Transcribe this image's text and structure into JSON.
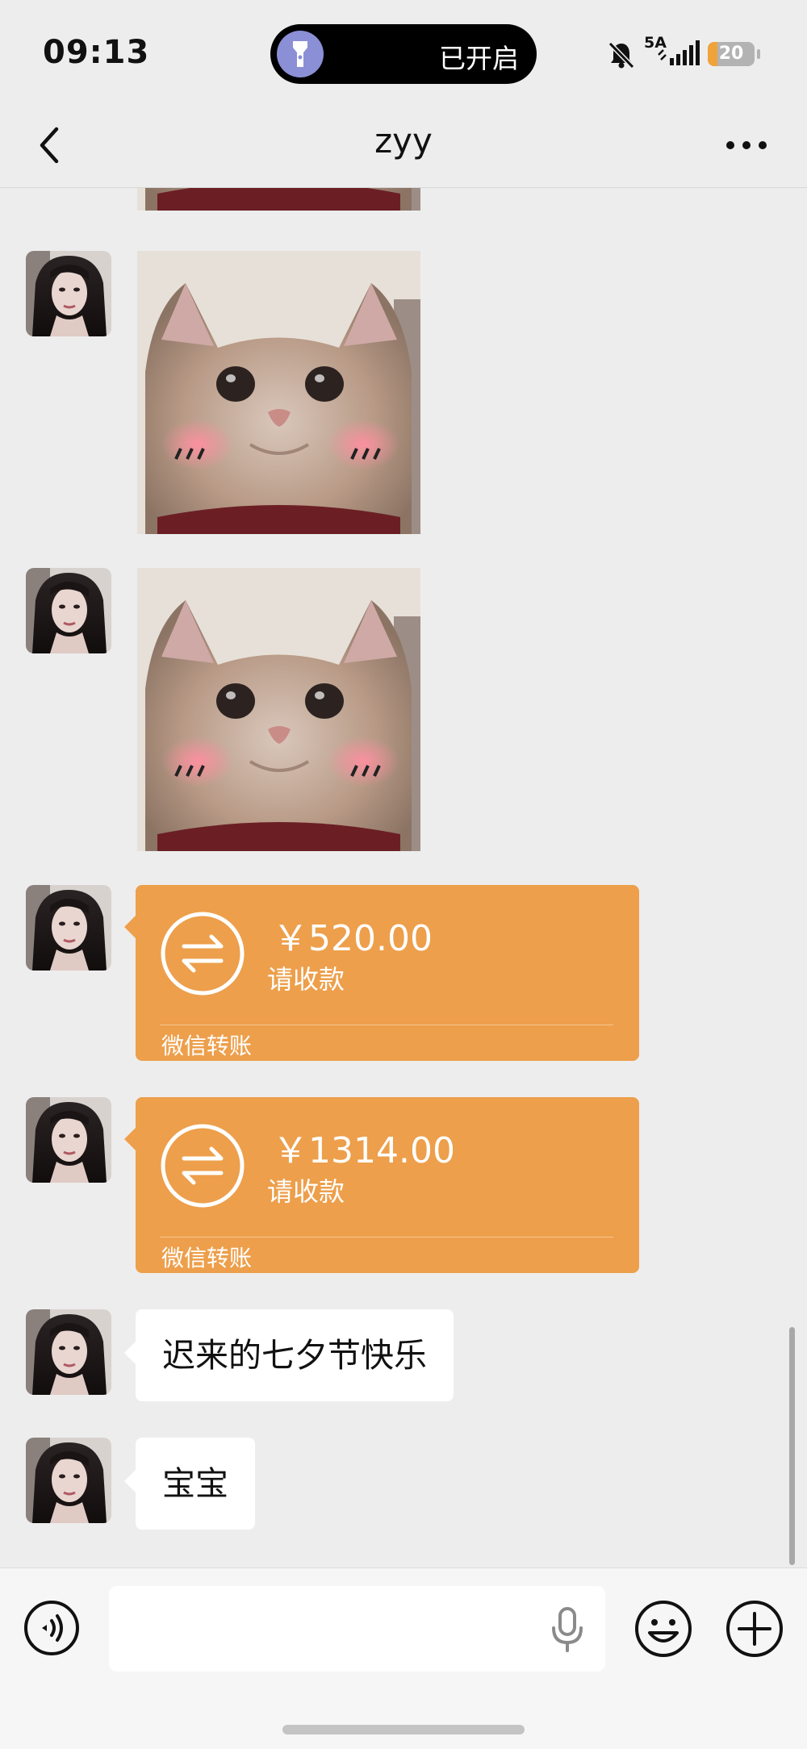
{
  "status_bar": {
    "time": "09:13",
    "island_text": "已开启",
    "network": "5A",
    "battery_level": "20",
    "battery_fraction": 0.2
  },
  "nav": {
    "title": "zyy",
    "back_icon": "chevron-left-icon",
    "more_icon": "more-dots-icon"
  },
  "messages": [
    {
      "type": "image",
      "sender": "contact",
      "description": "cat-sticker"
    },
    {
      "type": "image",
      "sender": "contact",
      "description": "cat-sticker"
    },
    {
      "type": "transfer",
      "sender": "contact",
      "amount": "￥520.00",
      "status": "请收款",
      "brand": "微信转账"
    },
    {
      "type": "transfer",
      "sender": "contact",
      "amount": "￥1314.00",
      "status": "请收款",
      "brand": "微信转账"
    },
    {
      "type": "text",
      "sender": "contact",
      "text": "迟来的七夕节快乐"
    },
    {
      "type": "text",
      "sender": "contact",
      "text": "宝宝"
    }
  ],
  "input_bar": {
    "placeholder": "",
    "voice_icon": "voice-mode-icon",
    "mic_icon": "microphone-icon",
    "emoji_icon": "emoji-icon",
    "plus_icon": "plus-icon"
  },
  "colors": {
    "background": "#ededed",
    "transfer": "#ed9f4b",
    "bubble": "#ffffff",
    "battery": "#f0a33a"
  }
}
